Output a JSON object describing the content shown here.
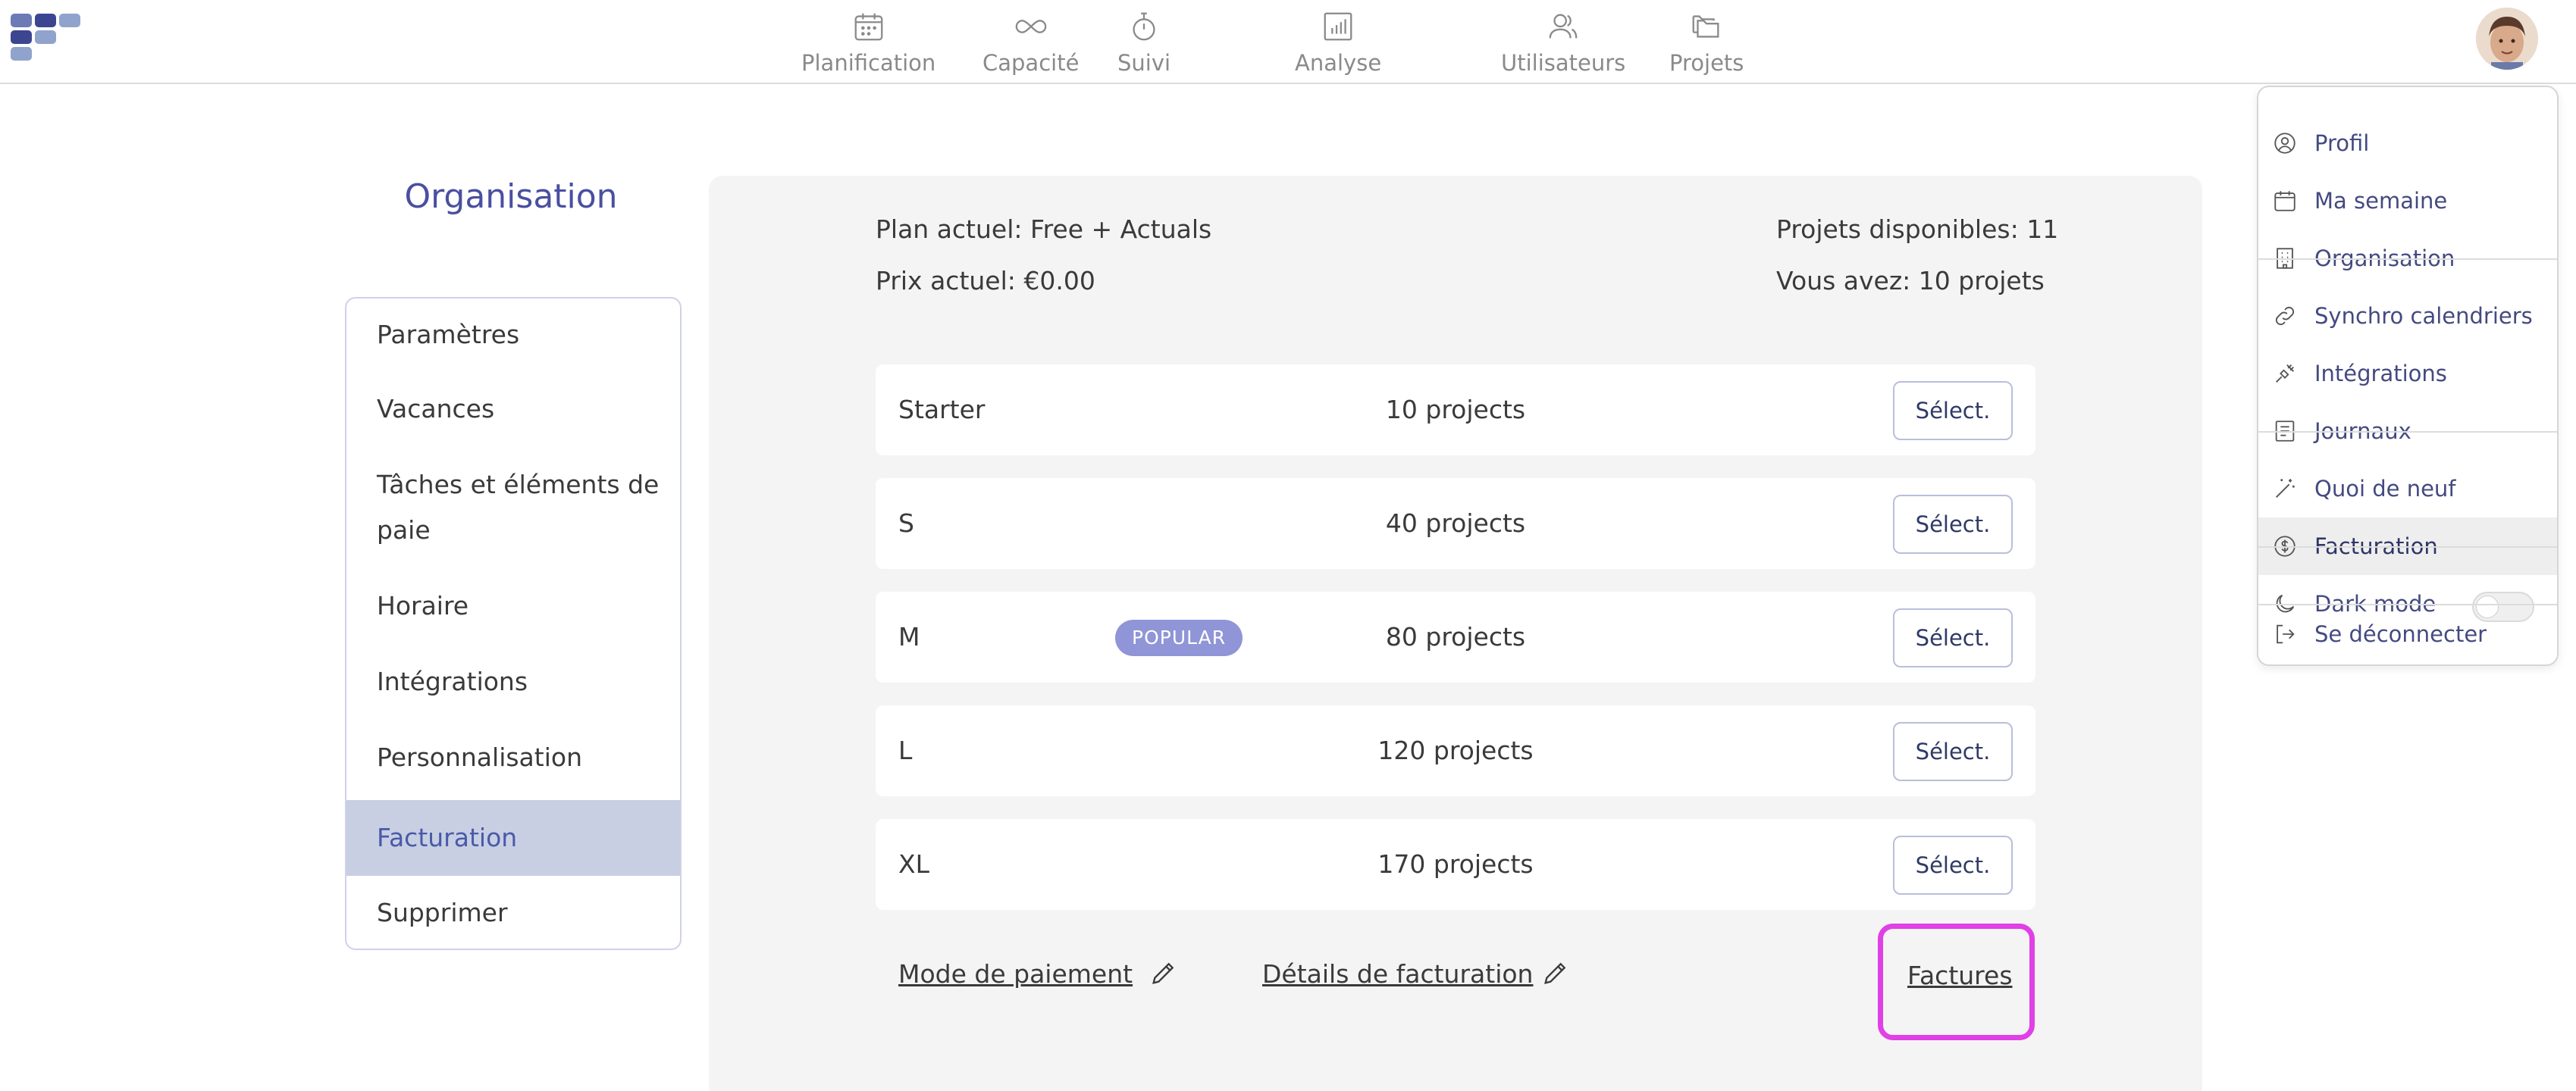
{
  "nav": {
    "items": [
      {
        "label": "Planification",
        "icon": "calendar-icon"
      },
      {
        "label": "Capacité",
        "icon": "infinity-icon"
      },
      {
        "label": "Suivi",
        "icon": "stopwatch-icon"
      },
      {
        "label": "Analyse",
        "icon": "bar-chart-icon"
      },
      {
        "label": "Utilisateurs",
        "icon": "users-icon"
      },
      {
        "label": "Projets",
        "icon": "folders-icon"
      }
    ]
  },
  "sidebar": {
    "title": "Organisation",
    "items": [
      {
        "label": "Paramètres"
      },
      {
        "label": "Vacances"
      },
      {
        "label": "Tâches et éléments de paie"
      },
      {
        "label": "Horaire"
      },
      {
        "label": "Intégrations"
      },
      {
        "label": "Personnalisation"
      },
      {
        "label": "Facturation",
        "active": true
      },
      {
        "label": "Supprimer"
      }
    ]
  },
  "billing": {
    "current_plan": "Plan actuel: Free + Actuals",
    "current_price": "Prix actuel: €0.00",
    "available_projects": "Projets disponibles: 11",
    "you_have": "Vous avez: 10 projets",
    "select_label": "Sélect.",
    "popular_badge": "POPULAR",
    "plans": [
      {
        "name": "Starter",
        "projects": "10 projects"
      },
      {
        "name": "S",
        "projects": "40 projects"
      },
      {
        "name": "M",
        "projects": "80 projects",
        "popular": true
      },
      {
        "name": "L",
        "projects": "120 projects"
      },
      {
        "name": "XL",
        "projects": "170 projects"
      }
    ],
    "payment_method_link": "Mode de paiement",
    "billing_details_link": "Détails de facturation",
    "invoices_link": "Factures"
  },
  "user_menu": {
    "items": [
      {
        "label": "Profil",
        "icon": "user-circle-icon"
      },
      {
        "label": "Ma semaine",
        "icon": "calendar-icon"
      },
      {
        "label": "Organisation",
        "icon": "building-icon"
      },
      {
        "label": "Synchro calendriers",
        "icon": "link-icon"
      },
      {
        "label": "Intégrations",
        "icon": "plug-icon"
      },
      {
        "label": "Journaux",
        "icon": "log-icon"
      },
      {
        "label": "Quoi de neuf",
        "icon": "magic-wand-icon"
      },
      {
        "label": "Facturation",
        "icon": "dollar-circle-icon",
        "active": true
      },
      {
        "label": "Dark mode",
        "icon": "moon-icon",
        "toggle": false
      },
      {
        "label": "Se déconnecter",
        "icon": "logout-icon"
      }
    ]
  },
  "colors": {
    "accent": "#4a4fa0",
    "active_sidebar_bg": "#c8cfe3",
    "panel_bg": "#f4f4f4",
    "badge_bg": "#8f95d6",
    "highlight": "#e040e6"
  }
}
